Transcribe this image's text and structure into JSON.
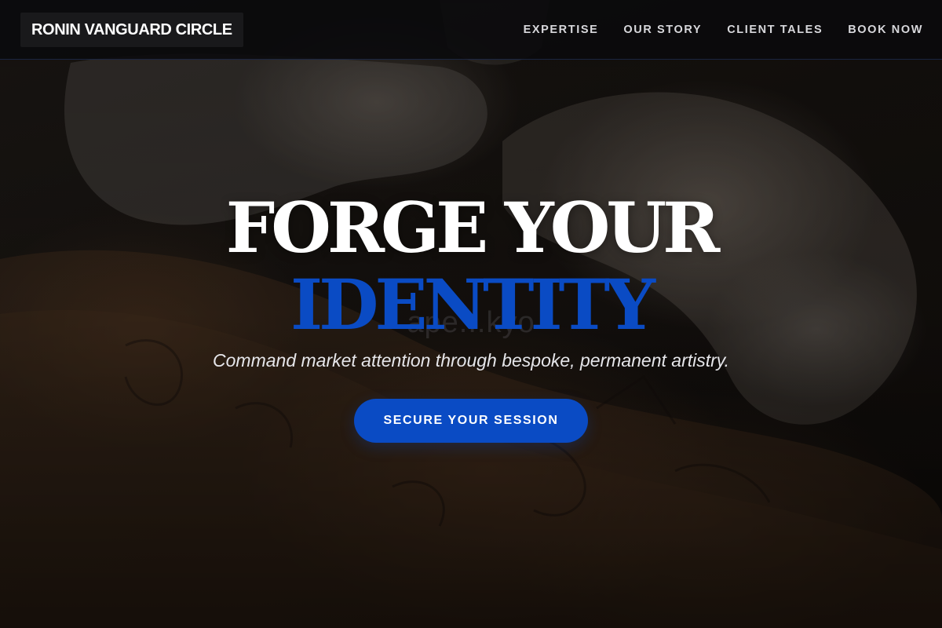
{
  "header": {
    "brand": "RONIN VANGUARD CIRCLE",
    "nav": [
      {
        "label": "EXPERTISE"
      },
      {
        "label": "OUR STORY"
      },
      {
        "label": "CLIENT TALES"
      },
      {
        "label": "BOOK NOW"
      }
    ]
  },
  "hero": {
    "headline_line1": "FORGE YOUR",
    "headline_line2": "IDENTITY",
    "watermark": "ape...kyo",
    "tagline": "Command market attention through bespoke, permanent artistry.",
    "cta_label": "SECURE YOUR SESSION"
  },
  "colors": {
    "accent": "#0a4bc4",
    "header_bg": "#0a0a0c",
    "text_light": "#ffffff"
  }
}
